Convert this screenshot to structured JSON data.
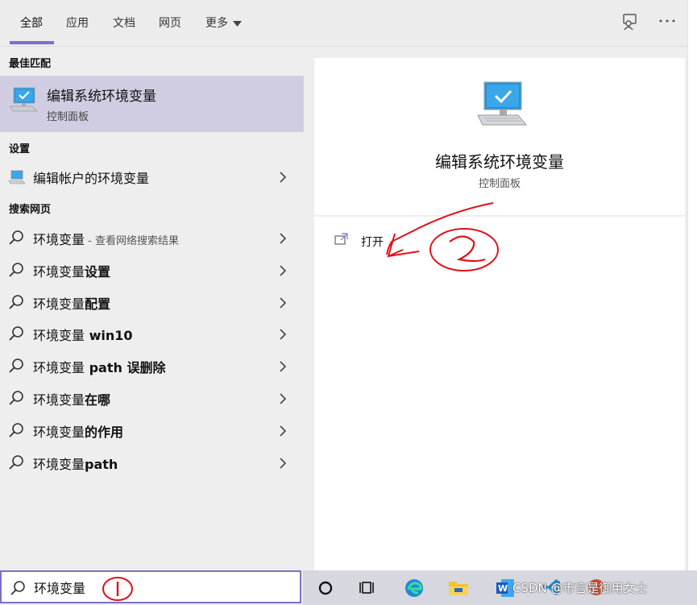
{
  "tabs": [
    {
      "label": "全部",
      "active": true
    },
    {
      "label": "应用",
      "active": false
    },
    {
      "label": "文档",
      "active": false
    },
    {
      "label": "网页",
      "active": false
    },
    {
      "label": "更多",
      "active": false
    }
  ],
  "top_icons": [
    "feedback-icon",
    "more-options-icon"
  ],
  "sections": {
    "best_match": "最佳匹配",
    "settings": "设置",
    "web": "搜索网页"
  },
  "best_match_item": {
    "title": "编辑系统环境变量",
    "subtitle": "控制面板",
    "icon": "monitor-check-icon"
  },
  "settings_items": [
    {
      "label": "编辑帐户的环境变量",
      "icon": "monitor-icon"
    }
  ],
  "web_items": [
    {
      "base": "环境变量",
      "bold": "",
      "hint": " - 查看网络搜索结果"
    },
    {
      "base": "环境变量",
      "bold": "设置",
      "hint": ""
    },
    {
      "base": "环境变量",
      "bold": "配置",
      "hint": ""
    },
    {
      "base": "环境变量",
      "bold": " win10",
      "hint": ""
    },
    {
      "base": "环境变量",
      "bold": " path 误删除",
      "hint": ""
    },
    {
      "base": "环境变量",
      "bold": "在哪",
      "hint": ""
    },
    {
      "base": "环境变量",
      "bold": "的作用",
      "hint": ""
    },
    {
      "base": "环境变量",
      "bold": "path",
      "hint": ""
    }
  ],
  "preview": {
    "title": "编辑系统环境变量",
    "subtitle": "控制面板",
    "actions": [
      {
        "label": "打开",
        "icon": "open-icon"
      }
    ]
  },
  "search": {
    "value": "环境变量",
    "icon": "search-icon"
  },
  "taskbar": {
    "items": [
      "cortana-icon",
      "task-view-icon",
      "edge-icon",
      "file-explorer-icon",
      "word-icon",
      "vscode-icon",
      "app-icon"
    ],
    "watermark": "CSDN @市言是御用女士"
  },
  "annotations": [
    "1",
    "2"
  ],
  "colors": {
    "accent": "#7a71c8",
    "best_match_bg": "#d0cde3",
    "annotation": "#e0101a"
  }
}
